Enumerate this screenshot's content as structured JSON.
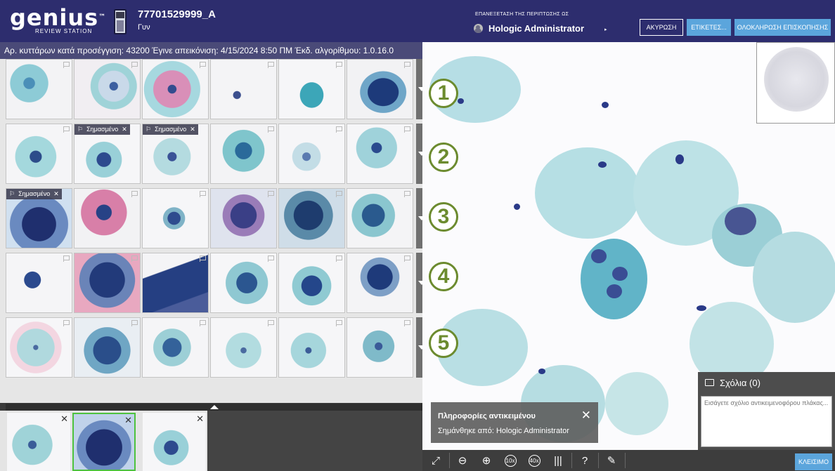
{
  "header": {
    "logo_text": "genius",
    "logo_tm": "™",
    "logo_sub": "REVIEW STATION",
    "case_id": "77701529999_A",
    "case_type": "Γυν",
    "reviewing_as_label": "ΕΠΑΝΕΞΕΤΑΣΗ ΤΗΣ ΠΕΡΙΠΤΩΣΗΣ ΩΣ",
    "user_name": "Hologic Administrator",
    "cancel_label": "ΑΚΥΡΩΣΗ",
    "labels_label": "ΕΤΙΚΕΤΕΣ...",
    "complete_label": "ΟΛΟΚΛΗΡΩΣΗ ΕΠΙΣΚΟΠΗΣΗΣ"
  },
  "infobar": {
    "text": "Αρ. κυττάρων κατά προσέγγιση: 43200  Έγινε απεικόνιση: 4/15/2024 8:50 ΠΜ  Έκδ. αλγορίθμου: 1.0.16.0"
  },
  "gallery": {
    "flagged_label": "Σημασμένο",
    "close_glyph": "✕",
    "row_numbers": [
      "1",
      "2",
      "3",
      "4",
      "5"
    ]
  },
  "comments": {
    "title": "Σχόλια (0)",
    "placeholder": "Εισάγετε σχόλιο αντικειμενοφόρου πλάκας..."
  },
  "object_info": {
    "title": "Πληροφορίες αντικειμένου",
    "flagged_by": "Σημάνθηκε από: Hologic Administrator",
    "close_glyph": "✕"
  },
  "toolbar": {
    "zoom10_label": "10x",
    "zoom40_label": "40x",
    "help_label": "?",
    "close_label": "ΚΛΕΙΣΙΜΟ"
  },
  "tray": {
    "close_glyph": "✕"
  },
  "colors": {
    "header_bg": "#2d2d6e",
    "accent_button": "#5ba5dc",
    "row_number": "#6c8b2f",
    "active_tile_border": "#4ec23e"
  }
}
